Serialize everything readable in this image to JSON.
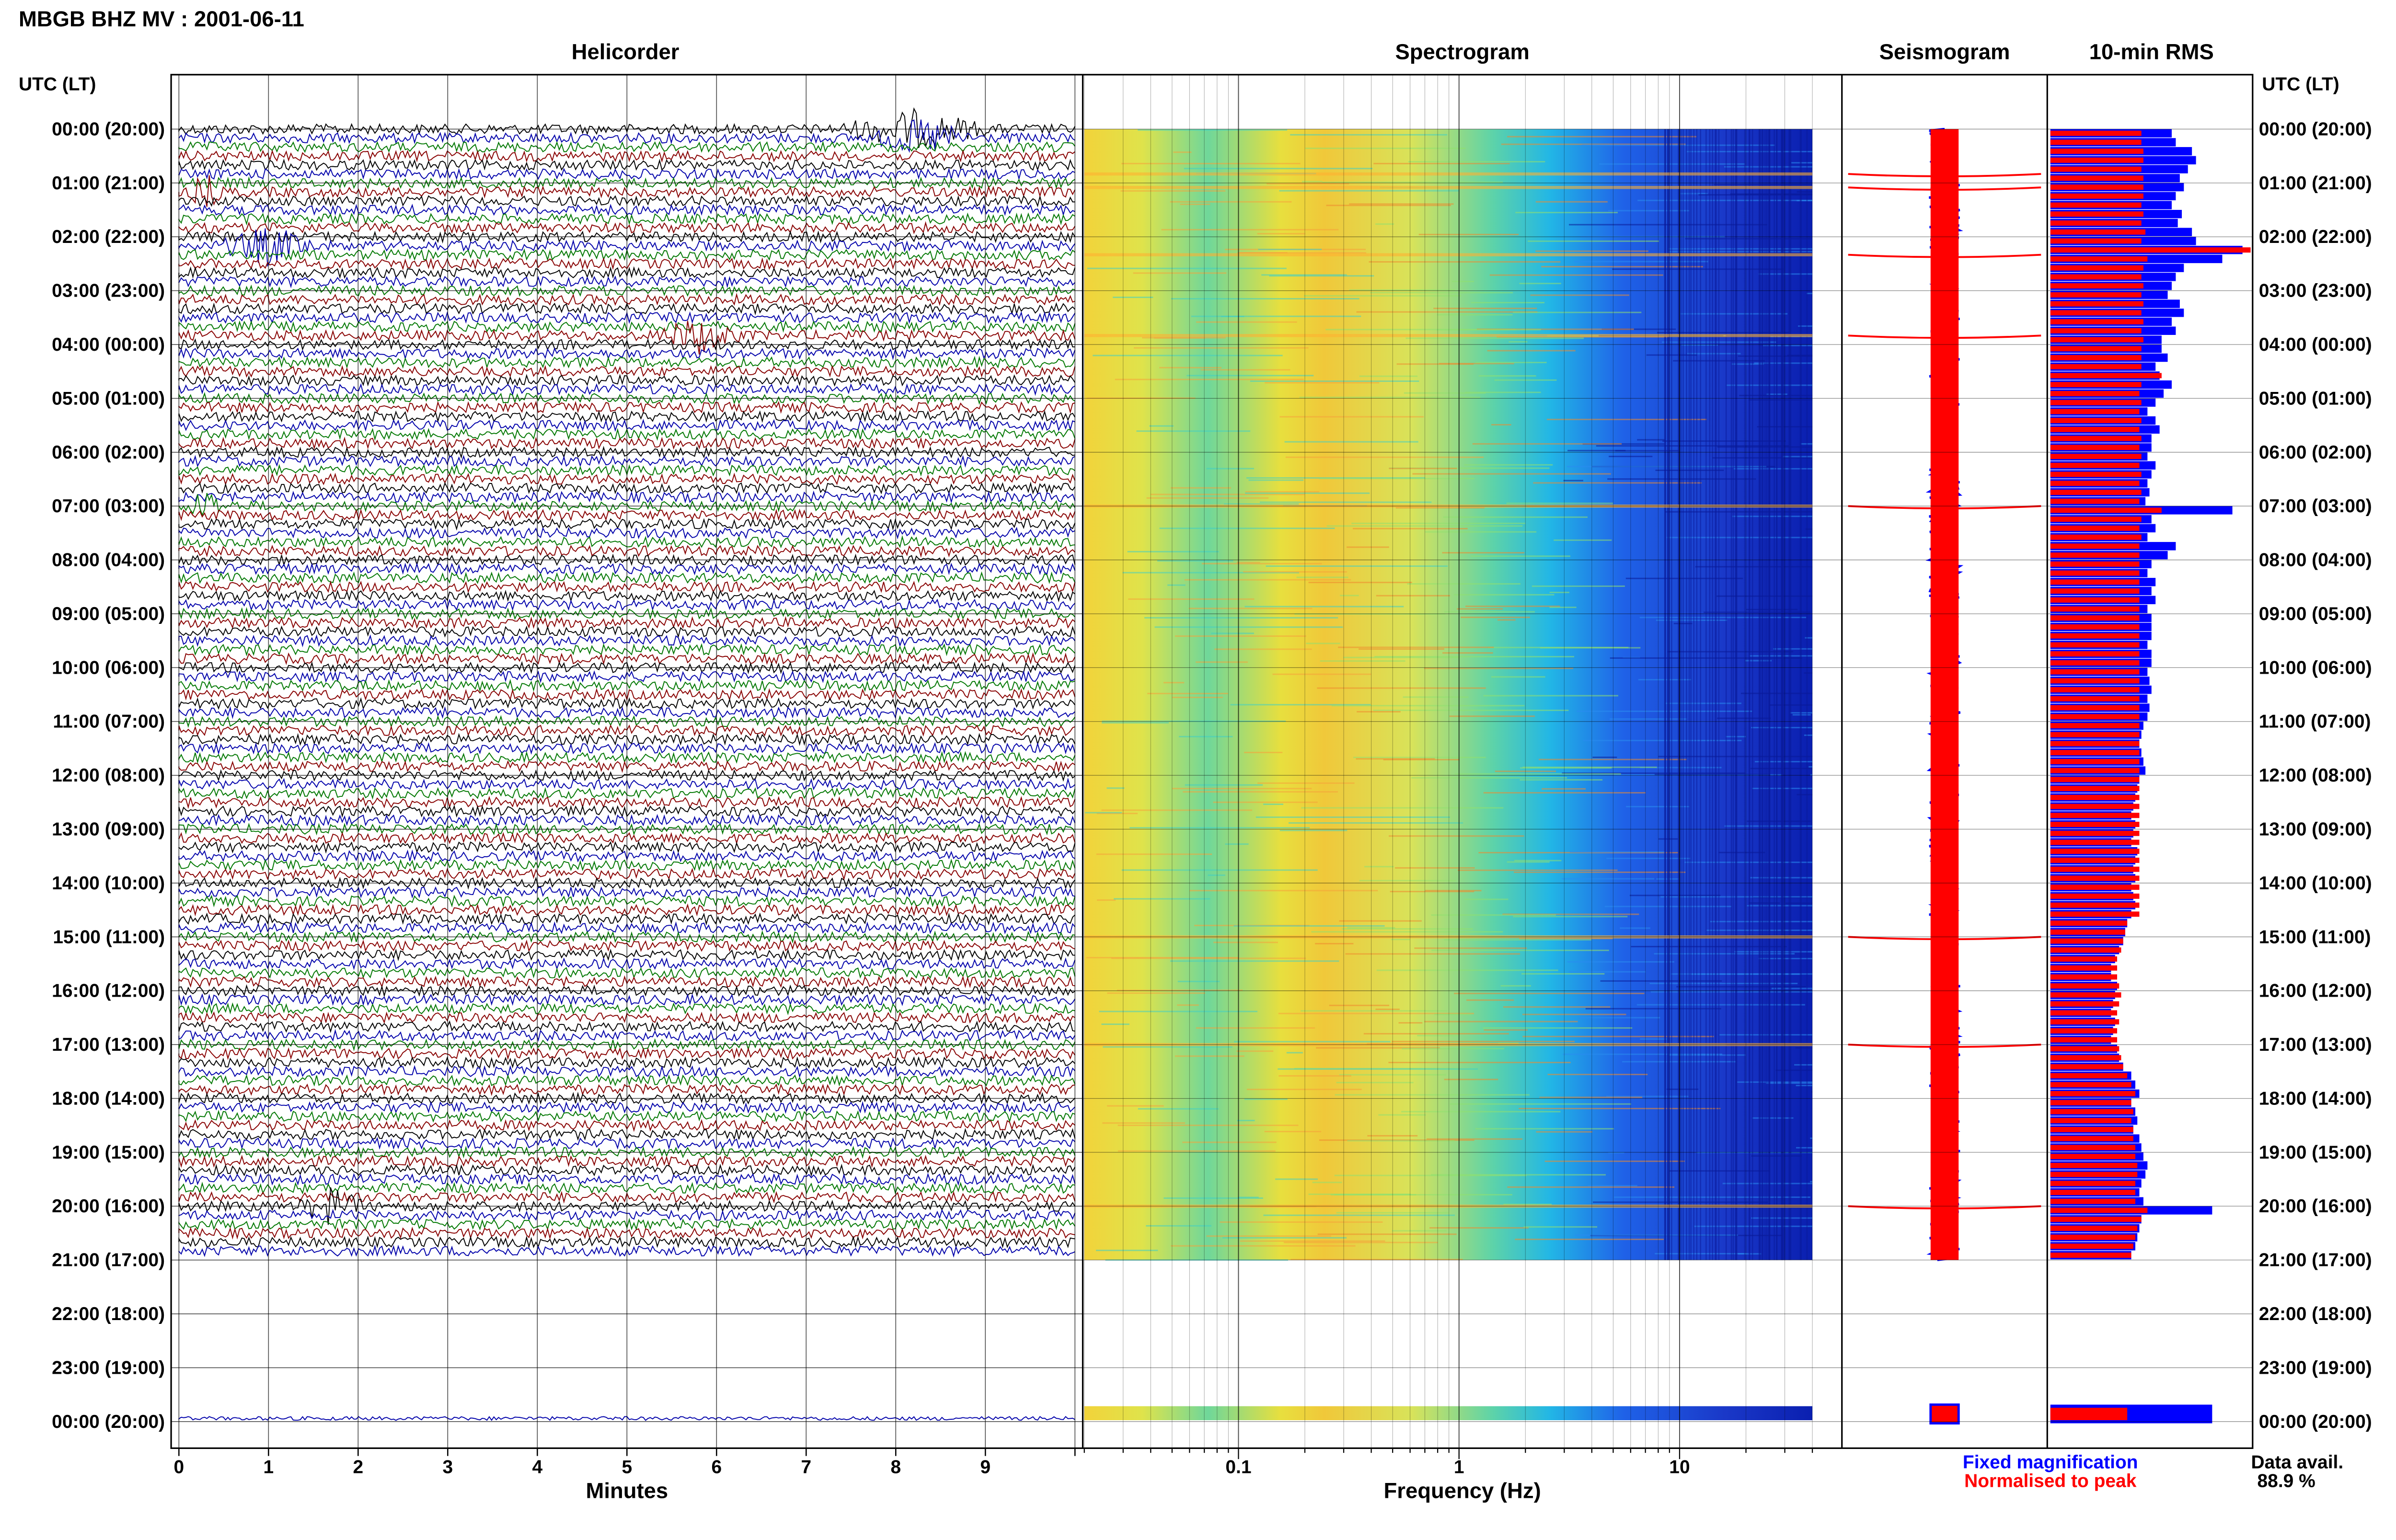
{
  "page_title": "MBGB BHZ MV : 2001-06-11",
  "panels": {
    "helicorder": "Helicorder",
    "spectrogram": "Spectrogram",
    "seismogram": "Seismogram",
    "rms": "10-min RMS"
  },
  "time_axis_label": "UTC (LT)",
  "time_labels": [
    "00:00 (20:00)",
    "01:00 (21:00)",
    "02:00 (22:00)",
    "03:00 (23:00)",
    "04:00 (00:00)",
    "05:00 (01:00)",
    "06:00 (02:00)",
    "07:00 (03:00)",
    "08:00 (04:00)",
    "09:00 (05:00)",
    "10:00 (06:00)",
    "11:00 (07:00)",
    "12:00 (08:00)",
    "13:00 (09:00)",
    "14:00 (10:00)",
    "15:00 (11:00)",
    "16:00 (12:00)",
    "17:00 (13:00)",
    "18:00 (14:00)",
    "19:00 (15:00)",
    "20:00 (16:00)",
    "21:00 (17:00)",
    "22:00 (18:00)",
    "23:00 (19:00)",
    "00:00 (20:00)"
  ],
  "minutes_axis": {
    "label": "Minutes",
    "ticks": [
      "0",
      "1",
      "2",
      "3",
      "4",
      "5",
      "6",
      "7",
      "8",
      "9"
    ]
  },
  "frequency_axis": {
    "label": "Frequency (Hz)",
    "ticks": [
      "0.1",
      "1",
      "10"
    ]
  },
  "legend": {
    "fixed": "Fixed magnification",
    "normalised": "Normalised to peak"
  },
  "data_avail": {
    "label": "Data avail.",
    "value": "88.9 %"
  },
  "colors": {
    "fixed": "#0000ff",
    "normalised": "#ff0000",
    "trace_cycle": [
      "#000000",
      "#0000aa",
      "#007700",
      "#880000"
    ]
  },
  "chart_data": {
    "type": "heatmap",
    "title": "MBGB BHZ MV : 2001-06-11",
    "time_range_utc": [
      "00:00",
      "00:00 next day"
    ],
    "data_gap_utc": [
      "21:00",
      "24:00"
    ],
    "helicorder": {
      "xlabel": "Minutes",
      "xlim": [
        0,
        10
      ],
      "rows_per_hour": 6
    },
    "spectrogram": {
      "xlabel": "Frequency (Hz)",
      "xscale": "log",
      "xlim": [
        0.02,
        40
      ]
    },
    "events_utc": [
      "00:50",
      "01:05",
      "02:20",
      "03:50",
      "07:00",
      "15:00",
      "17:00",
      "20:00"
    ],
    "rms_10min": {
      "series": [
        {
          "name": "Fixed magnification",
          "values": [
            0.6,
            0.62,
            0.7,
            0.72,
            0.68,
            0.64,
            0.66,
            0.62,
            0.6,
            0.65,
            0.63,
            0.7,
            0.72,
            0.95,
            0.85,
            0.66,
            0.62,
            0.6,
            0.58,
            0.64,
            0.66,
            0.6,
            0.62,
            0.55,
            0.55,
            0.58,
            0.52,
            0.54,
            0.6,
            0.56,
            0.52,
            0.48,
            0.52,
            0.54,
            0.5,
            0.5,
            0.48,
            0.52,
            0.5,
            0.48,
            0.49,
            0.47,
            0.9,
            0.5,
            0.52,
            0.48,
            0.62,
            0.58,
            0.5,
            0.48,
            0.52,
            0.5,
            0.52,
            0.48,
            0.5,
            0.5,
            0.5,
            0.48,
            0.5,
            0.5,
            0.48,
            0.49,
            0.5,
            0.48,
            0.49,
            0.48,
            0.46,
            0.45,
            0.44,
            0.45,
            0.46,
            0.47,
            0.44,
            0.43,
            0.42,
            0.41,
            0.4,
            0.42,
            0.41,
            0.4,
            0.43,
            0.42,
            0.41,
            0.42,
            0.4,
            0.41,
            0.42,
            0.4,
            0.38,
            0.37,
            0.36,
            0.34,
            0.32,
            0.3,
            0.3,
            0.33,
            0.32,
            0.31,
            0.3,
            0.32,
            0.31,
            0.3,
            0.33,
            0.34,
            0.36,
            0.4,
            0.42,
            0.44,
            0.4,
            0.42,
            0.43,
            0.41,
            0.44,
            0.45,
            0.46,
            0.48,
            0.47,
            0.45,
            0.44,
            0.46,
            0.8,
            0.45,
            0.44,
            0.43,
            0.42,
            0.4
          ]
        },
        {
          "name": "Normalised to peak",
          "values": [
            0.45,
            0.45,
            0.46,
            0.46,
            0.45,
            0.46,
            0.46,
            0.46,
            0.45,
            0.46,
            0.45,
            0.47,
            0.45,
            0.99,
            0.48,
            0.46,
            0.45,
            0.46,
            0.45,
            0.46,
            0.45,
            0.46,
            0.45,
            0.46,
            0.45,
            0.45,
            0.45,
            0.55,
            0.45,
            0.44,
            0.45,
            0.44,
            0.45,
            0.44,
            0.45,
            0.44,
            0.45,
            0.44,
            0.45,
            0.44,
            0.45,
            0.44,
            0.55,
            0.45,
            0.44,
            0.45,
            0.44,
            0.44,
            0.44,
            0.44,
            0.44,
            0.44,
            0.44,
            0.44,
            0.44,
            0.44,
            0.44,
            0.44,
            0.44,
            0.44,
            0.44,
            0.44,
            0.44,
            0.44,
            0.44,
            0.44,
            0.44,
            0.44,
            0.44,
            0.44,
            0.44,
            0.44,
            0.44,
            0.44,
            0.44,
            0.44,
            0.44,
            0.44,
            0.44,
            0.44,
            0.44,
            0.44,
            0.44,
            0.44,
            0.44,
            0.44,
            0.44,
            0.44,
            0.38,
            0.37,
            0.36,
            0.35,
            0.33,
            0.33,
            0.33,
            0.34,
            0.35,
            0.34,
            0.33,
            0.34,
            0.33,
            0.33,
            0.34,
            0.35,
            0.36,
            0.38,
            0.4,
            0.42,
            0.4,
            0.41,
            0.4,
            0.41,
            0.41,
            0.42,
            0.42,
            0.43,
            0.43,
            0.42,
            0.42,
            0.42,
            0.48,
            0.45,
            0.43,
            0.42,
            0.41,
            0.4
          ]
        }
      ]
    },
    "data_avail_percent": 88.9
  }
}
